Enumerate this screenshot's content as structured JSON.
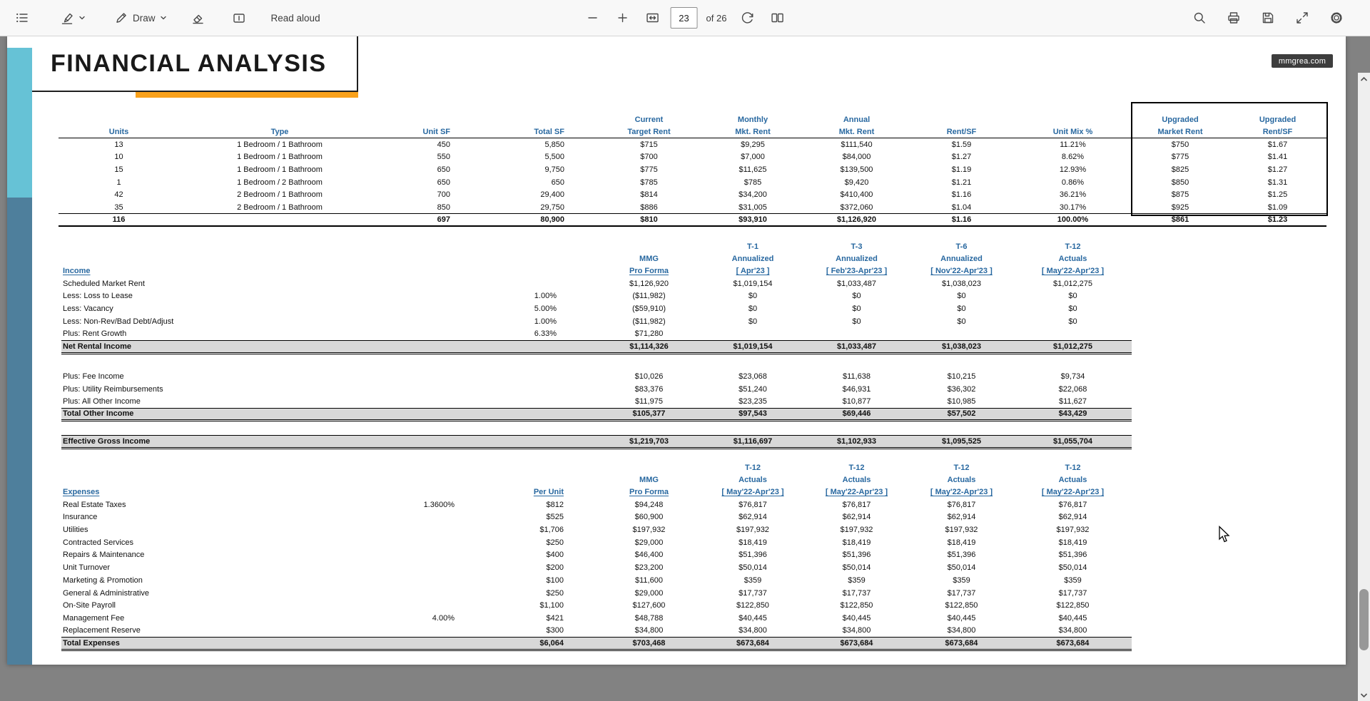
{
  "toolbar": {
    "left_icons": [
      "table-of-contents",
      "highlighter",
      "draw-pen",
      "eraser",
      "add-text"
    ],
    "draw_label": "Draw",
    "read_aloud_label": "Read aloud",
    "page_input_value": "23",
    "page_count_label": "of 26",
    "right_icons": [
      "search",
      "print",
      "save",
      "fullscreen",
      "settings"
    ]
  },
  "document": {
    "title": "FINANCIAL ANALYSIS",
    "watermark": "mmgrea.com"
  },
  "colors": {
    "header_blue": "#2868a0",
    "accent_orange": "#f9a11b",
    "teal_bar": "#66c2d6",
    "slate_bar": "#4e7f9c",
    "total_row_bg": "#d8d8d8"
  },
  "tables": {
    "unit_mix": {
      "header_rows": [
        [
          "",
          "",
          "",
          "",
          "Current",
          "Monthly",
          "Annual",
          "",
          "",
          "Upgraded",
          "Upgraded"
        ],
        [
          "Units",
          "Type",
          "Unit SF",
          "Total SF",
          "Target Rent",
          "Mkt. Rent",
          "Mkt. Rent",
          "Rent/SF",
          "Unit Mix %",
          "Market Rent",
          "Rent/SF"
        ]
      ],
      "rows": [
        {
          "cells": [
            "13",
            "1 Bedroom / 1 Bathroom",
            "450",
            "5,850",
            "$715",
            "$9,295",
            "$111,540",
            "$1.59",
            "11.21%",
            "$750",
            "$1.67"
          ]
        },
        {
          "cells": [
            "10",
            "1 Bedroom / 1 Bathroom",
            "550",
            "5,500",
            "$700",
            "$7,000",
            "$84,000",
            "$1.27",
            "8.62%",
            "$775",
            "$1.41"
          ]
        },
        {
          "cells": [
            "15",
            "1 Bedroom / 1 Bathroom",
            "650",
            "9,750",
            "$775",
            "$11,625",
            "$139,500",
            "$1.19",
            "12.93%",
            "$825",
            "$1.27"
          ]
        },
        {
          "cells": [
            "1",
            "1 Bedroom / 2 Bathroom",
            "650",
            "650",
            "$785",
            "$785",
            "$9,420",
            "$1.21",
            "0.86%",
            "$850",
            "$1.31"
          ]
        },
        {
          "cells": [
            "42",
            "2 Bedroom / 1 Bathroom",
            "700",
            "29,400",
            "$814",
            "$34,200",
            "$410,400",
            "$1.16",
            "36.21%",
            "$875",
            "$1.25"
          ]
        },
        {
          "cells": [
            "35",
            "2 Bedroom / 1 Bathroom",
            "850",
            "29,750",
            "$886",
            "$31,005",
            "$372,060",
            "$1.04",
            "30.17%",
            "$925",
            "$1.09"
          ]
        },
        {
          "style": "grand",
          "cells": [
            "116",
            "",
            "697",
            "80,900",
            "$810",
            "$93,910",
            "$1,126,920",
            "$1.16",
            "100.00%",
            "$861",
            "$1.23"
          ]
        }
      ]
    },
    "income": {
      "header_rows": [
        [
          "",
          "",
          "",
          "T-1",
          "T-3",
          "T-6",
          "T-12"
        ],
        [
          "",
          "",
          "MMG",
          "Annualized",
          "Annualized",
          "Annualized",
          "Actuals"
        ],
        [
          "Income",
          "",
          "Pro Forma",
          "[ Apr'23 ]",
          "[ Feb'23-Apr'23 ]",
          "[ Nov'22-Apr'23 ]",
          "[ May'22-Apr'23 ]"
        ]
      ],
      "rows": [
        {
          "cells": [
            "Scheduled Market Rent",
            "",
            "$1,126,920",
            "$1,019,154",
            "$1,033,487",
            "$1,038,023",
            "$1,012,275"
          ]
        },
        {
          "cells": [
            "Less: Loss to Lease",
            "1.00%",
            "($11,982)",
            "$0",
            "$0",
            "$0",
            "$0"
          ]
        },
        {
          "cells": [
            "Less: Vacancy",
            "5.00%",
            "($59,910)",
            "$0",
            "$0",
            "$0",
            "$0"
          ]
        },
        {
          "cells": [
            "Less: Non-Rev/Bad Debt/Adjust",
            "1.00%",
            "($11,982)",
            "$0",
            "$0",
            "$0",
            "$0"
          ]
        },
        {
          "cells": [
            "Plus: Rent Growth",
            "6.33%",
            "$71,280",
            "",
            "",
            "",
            ""
          ]
        },
        {
          "style": "total",
          "cells": [
            "Net Rental Income",
            "",
            "$1,114,326",
            "$1,019,154",
            "$1,033,487",
            "$1,038,023",
            "$1,012,275"
          ]
        },
        {
          "style": "spacer",
          "h": 24
        },
        {
          "cells": [
            "Plus: Fee Income",
            "",
            "$10,026",
            "$23,068",
            "$11,638",
            "$10,215",
            "$9,734"
          ]
        },
        {
          "cells": [
            "Plus: Utility Reimbursements",
            "",
            "$83,376",
            "$51,240",
            "$46,931",
            "$36,302",
            "$22,068"
          ]
        },
        {
          "cells": [
            "Plus: All Other Income",
            "",
            "$11,975",
            "$23,235",
            "$10,877",
            "$10,985",
            "$11,627"
          ]
        },
        {
          "style": "total",
          "cells": [
            "Total Other Income",
            "",
            "$105,377",
            "$97,543",
            "$69,446",
            "$57,502",
            "$43,429"
          ]
        },
        {
          "style": "spacer",
          "h": 21
        },
        {
          "style": "total",
          "cells": [
            "Effective Gross Income",
            "",
            "$1,219,703",
            "$1,116,697",
            "$1,102,933",
            "$1,095,525",
            "$1,055,704"
          ]
        }
      ]
    },
    "expenses": {
      "header_rows": [
        [
          "",
          "",
          "",
          "",
          "T-12",
          "T-12",
          "T-12",
          "T-12"
        ],
        [
          "",
          "",
          "",
          "MMG",
          "Actuals",
          "Actuals",
          "Actuals",
          "Actuals"
        ],
        [
          "Expenses",
          "",
          "Per Unit",
          "Pro Forma",
          "[ May'22-Apr'23 ]",
          "[ May'22-Apr'23 ]",
          "[ May'22-Apr'23 ]",
          "[ May'22-Apr'23 ]"
        ]
      ],
      "rows": [
        {
          "cells": [
            "Real Estate Taxes",
            "1.3600%",
            "$812",
            "$94,248",
            "$76,817",
            "$76,817",
            "$76,817",
            "$76,817"
          ]
        },
        {
          "cells": [
            "Insurance",
            "",
            "$525",
            "$60,900",
            "$62,914",
            "$62,914",
            "$62,914",
            "$62,914"
          ]
        },
        {
          "cells": [
            "Utilities",
            "",
            "$1,706",
            "$197,932",
            "$197,932",
            "$197,932",
            "$197,932",
            "$197,932"
          ]
        },
        {
          "cells": [
            "Contracted Services",
            "",
            "$250",
            "$29,000",
            "$18,419",
            "$18,419",
            "$18,419",
            "$18,419"
          ]
        },
        {
          "cells": [
            "Repairs & Maintenance",
            "",
            "$400",
            "$46,400",
            "$51,396",
            "$51,396",
            "$51,396",
            "$51,396"
          ]
        },
        {
          "cells": [
            "Unit Turnover",
            "",
            "$200",
            "$23,200",
            "$50,014",
            "$50,014",
            "$50,014",
            "$50,014"
          ]
        },
        {
          "cells": [
            "Marketing & Promotion",
            "",
            "$100",
            "$11,600",
            "$359",
            "$359",
            "$359",
            "$359"
          ]
        },
        {
          "cells": [
            "General & Administrative",
            "",
            "$250",
            "$29,000",
            "$17,737",
            "$17,737",
            "$17,737",
            "$17,737"
          ]
        },
        {
          "cells": [
            "On-Site Payroll",
            "",
            "$1,100",
            "$127,600",
            "$122,850",
            "$122,850",
            "$122,850",
            "$122,850"
          ]
        },
        {
          "cells": [
            "Management Fee",
            "4.00%",
            "$421",
            "$48,788",
            "$40,445",
            "$40,445",
            "$40,445",
            "$40,445"
          ]
        },
        {
          "cells": [
            "Replacement Reserve",
            "",
            "$300",
            "$34,800",
            "$34,800",
            "$34,800",
            "$34,800",
            "$34,800"
          ]
        },
        {
          "style": "total",
          "cells": [
            "Total Expenses",
            "",
            "$6,064",
            "$703,468",
            "$673,684",
            "$673,684",
            "$673,684",
            "$673,684"
          ]
        }
      ]
    }
  }
}
